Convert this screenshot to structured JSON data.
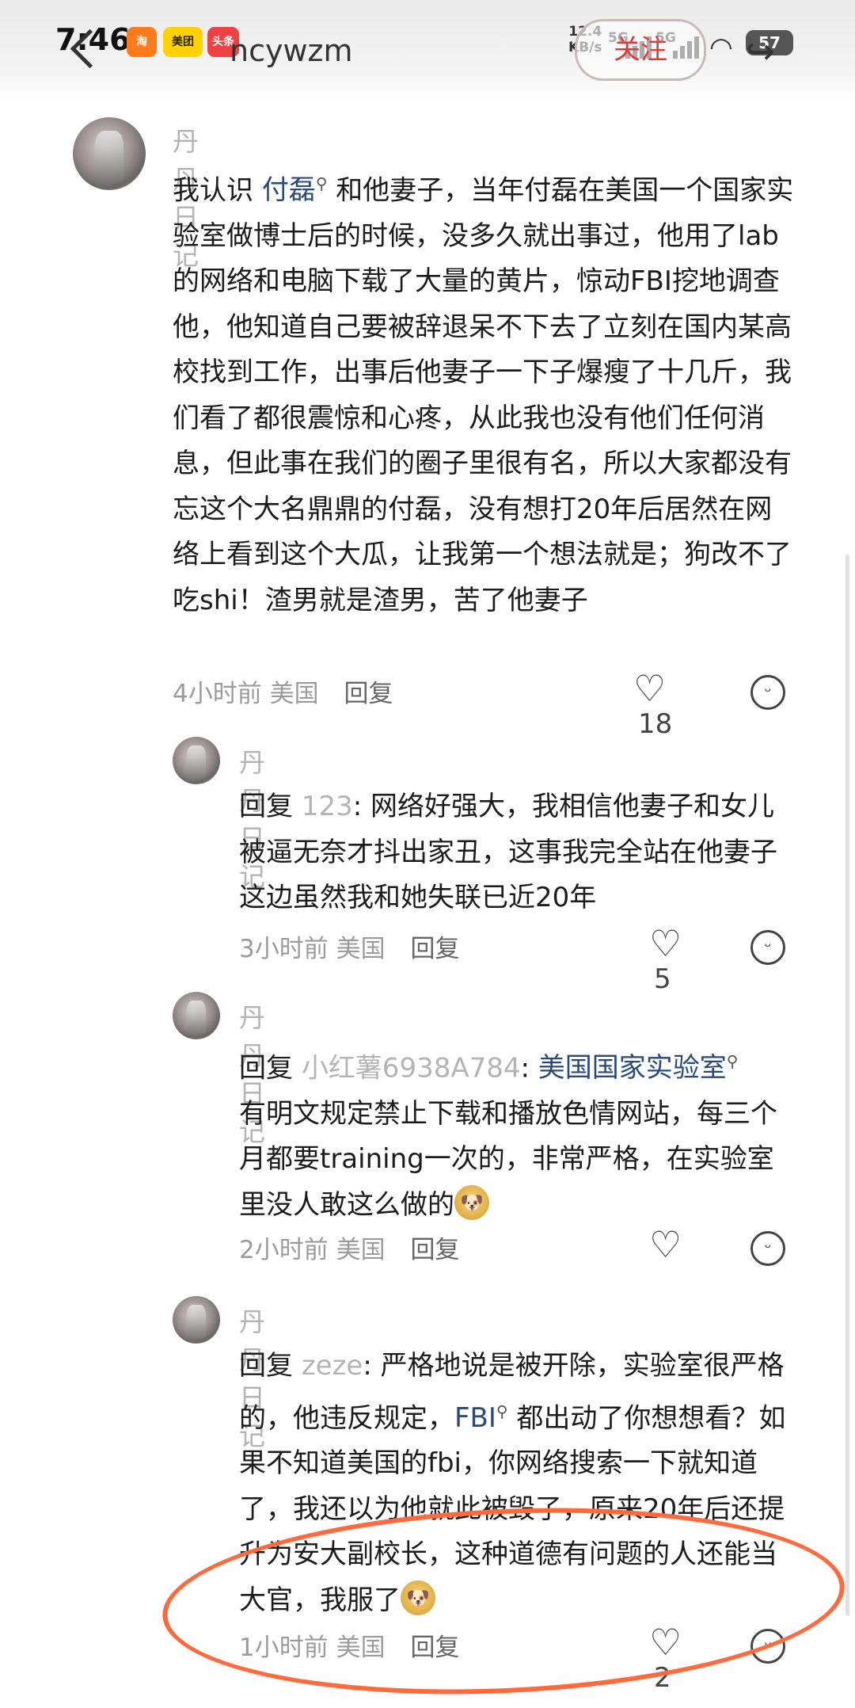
{
  "status_bar": {
    "time": "7:46",
    "apps": [
      "淘",
      "美团",
      "头条"
    ],
    "net_speed_value": "12.4",
    "net_speed_unit": "KB/s",
    "sim1": "5G",
    "sim2": "5G",
    "battery": "57"
  },
  "header": {
    "username": "ncywzm",
    "follow_label": "关注"
  },
  "comments": [
    {
      "author": "丹丹日记",
      "text_before": "我认识 ",
      "keyword": "付磊",
      "text_after": " 和他妻子，当年付磊在美国一个国家实验室做博士后的时候，没多久就出事过，他用了lab的网络和电脑下载了大量的黄片，惊动FBI挖地调查他，他知道自己要被辞退呆不下去了立刻在国内某高校找到工作，出事后他妻子一下子爆瘦了十几斤，我们看了都很震惊和心疼，从此我也没有他们任何消息，但此事在我们的圈子里很有名，所以大家都没有忘这个大名鼎鼎的付磊，没有想打20年后居然在网络上看到这个大瓜，让我第一个想法就是；狗改不了吃shi！渣男就是渣男，苦了他妻子",
      "time": "4小时前",
      "location": "美国",
      "reply_label": "回复",
      "likes": "18"
    },
    {
      "author": "丹丹日记",
      "reply_prefix": "回复 ",
      "reply_to": "123",
      "text": ": 网络好强大，我相信他妻子和女儿被逼无奈才抖出家丑，这事我完全站在他妻子这边虽然我和她失联已近20年",
      "time": "3小时前",
      "location": "美国",
      "reply_label": "回复",
      "likes": "5"
    },
    {
      "author": "丹丹日记",
      "reply_prefix": "回复 ",
      "reply_to": "小红薯6938A784",
      "sep": ": ",
      "keyword": "美国国家实验室",
      "text": "有明文规定禁止下载和播放色情网站，每三个月都要training一次的，非常严格，在实验室里没人敢这么做的",
      "time": "2小时前",
      "location": "美国",
      "reply_label": "回复",
      "likes": ""
    },
    {
      "author": "丹丹日记",
      "reply_prefix": "回复 ",
      "reply_to": "zeze",
      "text_before": ": 严格地说是被开除，实验室很严格的，他违反规定，",
      "keyword": "FBI",
      "text_after": " 都出动了你想想看？如果不知道美国的fbi，你网络搜索一下就知道了，我还以为他就此被毁了，原来20年后还提升为安大副校长，这种道德有问题的人还能当大官，我服了",
      "time": "1小时前",
      "location": "美国",
      "reply_label": "回复",
      "likes": "2"
    }
  ],
  "colors": {
    "annotation": "#ff6a3c",
    "keyword": "#2a4a7a",
    "muted": "#b4b4b4",
    "follow": "#e03a3a"
  }
}
